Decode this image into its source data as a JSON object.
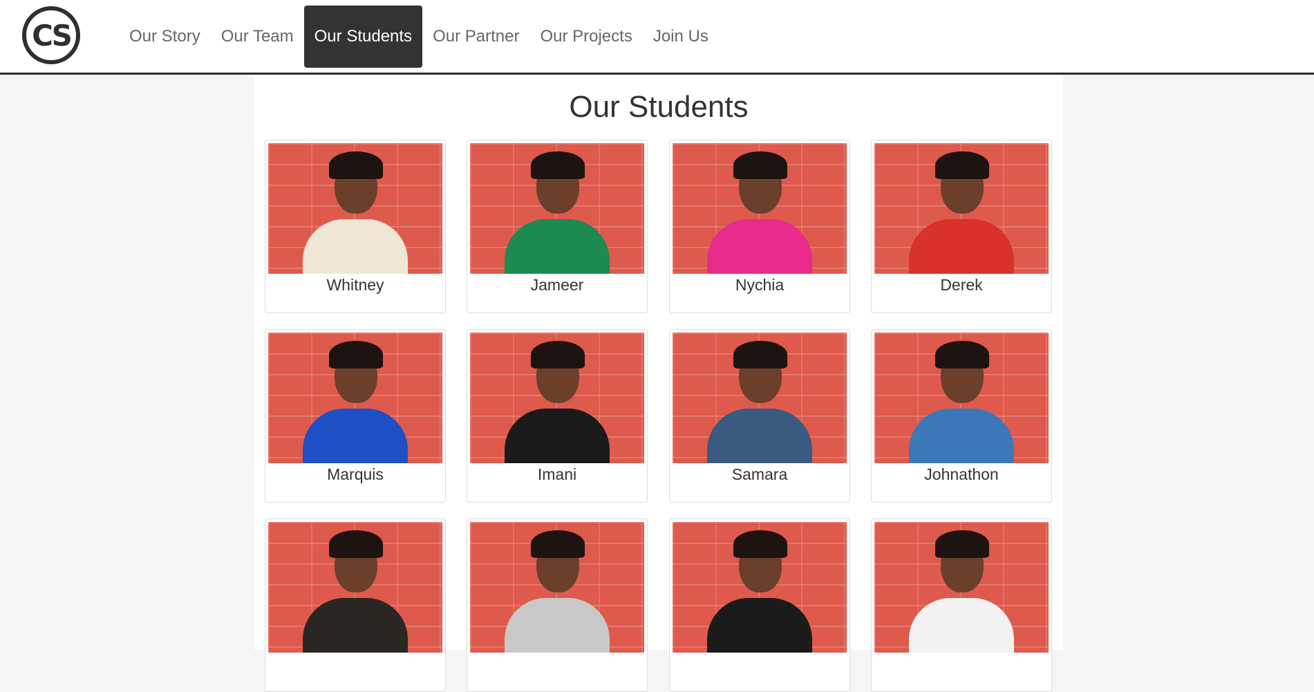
{
  "logo": {
    "text": "CS"
  },
  "nav": {
    "items": [
      "Our Story",
      "Our Team",
      "Our Students",
      "Our Partner",
      "Our Projects",
      "Join Us"
    ],
    "active": "Our Students"
  },
  "page": {
    "title": "Our Students"
  },
  "students": [
    {
      "name": "Whitney",
      "shirt_color": "#efe6d6"
    },
    {
      "name": "Jameer",
      "shirt_color": "#1d8a52"
    },
    {
      "name": "Nychia",
      "shirt_color": "#e82a8a"
    },
    {
      "name": "Derek",
      "shirt_color": "#d9322a"
    },
    {
      "name": "Marquis",
      "shirt_color": "#1f4fc4"
    },
    {
      "name": "Imani",
      "shirt_color": "#1a1a1a"
    },
    {
      "name": "Samara",
      "shirt_color": "#3b5a80"
    },
    {
      "name": "Johnathon",
      "shirt_color": "#3c78b8"
    },
    {
      "name": "",
      "shirt_color": "#2a2624"
    },
    {
      "name": "",
      "shirt_color": "#c8c8c8"
    },
    {
      "name": "",
      "shirt_color": "#1b1b1b"
    },
    {
      "name": "",
      "shirt_color": "#f2f2f2"
    }
  ]
}
